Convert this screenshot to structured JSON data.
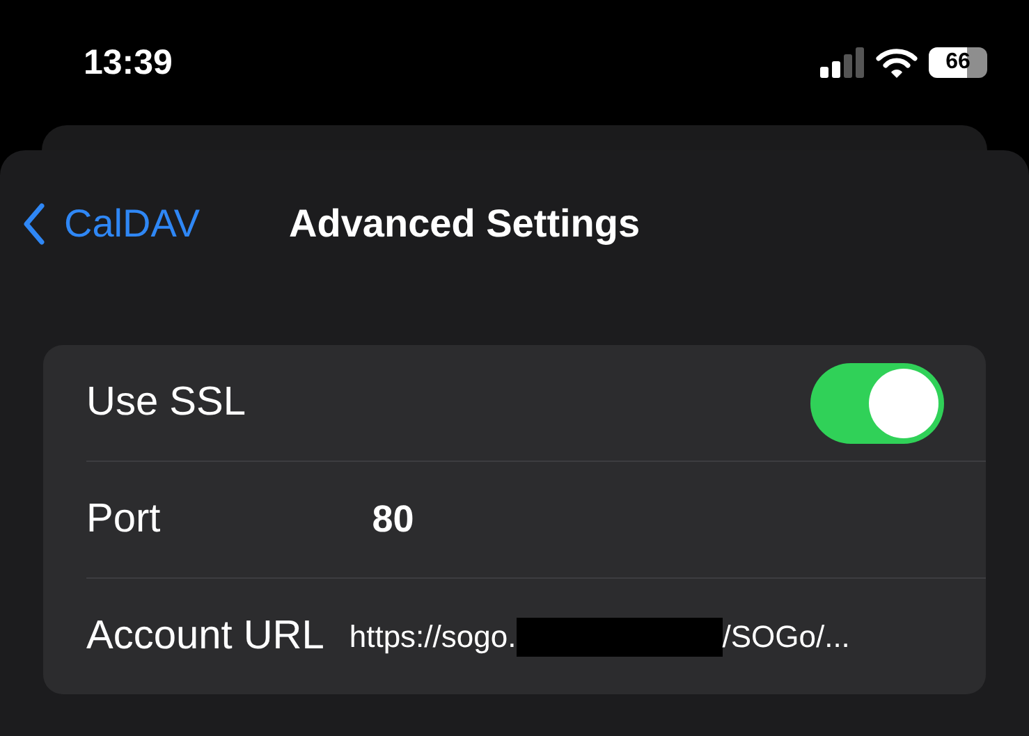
{
  "status_bar": {
    "time": "13:39",
    "battery": "66"
  },
  "nav": {
    "back": "CalDAV",
    "title": "Advanced Settings"
  },
  "rows": [
    {
      "kind": "toggle",
      "label": "Use SSL",
      "on": true
    },
    {
      "kind": "value",
      "label": "Port",
      "value": "80"
    },
    {
      "kind": "url",
      "label": "Account URL",
      "prefix": "https://sogo.",
      "suffix": "/SOGo/..."
    }
  ]
}
